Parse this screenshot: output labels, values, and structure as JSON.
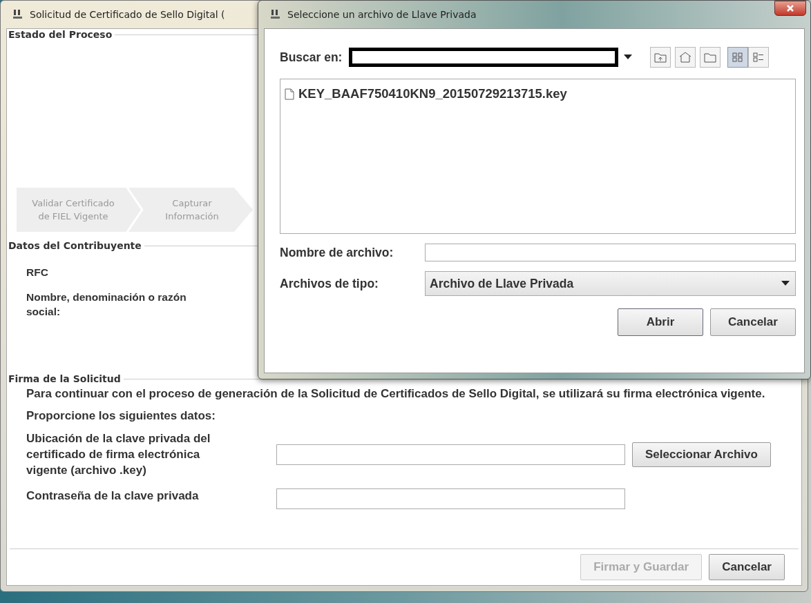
{
  "main_window": {
    "title": "Solicitud de Certificado de Sello Digital (",
    "process_status": {
      "legend": "Estado del Proceso",
      "steps": [
        {
          "label": "Validar Certificado de FIEL Vigente"
        },
        {
          "label": "Capturar Información"
        }
      ]
    },
    "taxpayer_data": {
      "legend": "Datos del Contribuyente",
      "fields": [
        {
          "label": "RFC"
        },
        {
          "label": "Nombre, denominación o razón social:"
        }
      ]
    },
    "signature": {
      "legend": "Firma de la Solicitud",
      "intro": "Para continuar con el proceso de generación de la Solicitud de Certificados de Sello Digital, se utilizará su firma electrónica vigente.",
      "prompt": "Proporcione los siguientes datos:",
      "key_file_label": "Ubicación de la clave privada del certificado de firma electrónica vigente (archivo .key)",
      "select_button": "Seleccionar Archivo",
      "password_label": "Contraseña de la clave privada"
    },
    "buttons": [
      {
        "label": "Firmar y Guardar",
        "disabled": true
      },
      {
        "label": "Cancelar",
        "disabled": false
      }
    ]
  },
  "file_dialog": {
    "title": "Seleccione un archivo de Llave Privada",
    "look_in_label": "Buscar en:",
    "view_buttons": [
      {
        "kind": "list",
        "selected": true
      },
      {
        "kind": "details",
        "selected": false
      }
    ],
    "files": [
      {
        "name": "KEY_BAAF750410KN9_20150729213715.key"
      }
    ],
    "file_name_label": "Nombre de archivo:",
    "file_type_label": "Archivos de tipo:",
    "file_type_value": "Archivo de Llave Privada",
    "buttons": [
      {
        "label": "Abrir"
      },
      {
        "label": "Cancelar"
      }
    ]
  }
}
